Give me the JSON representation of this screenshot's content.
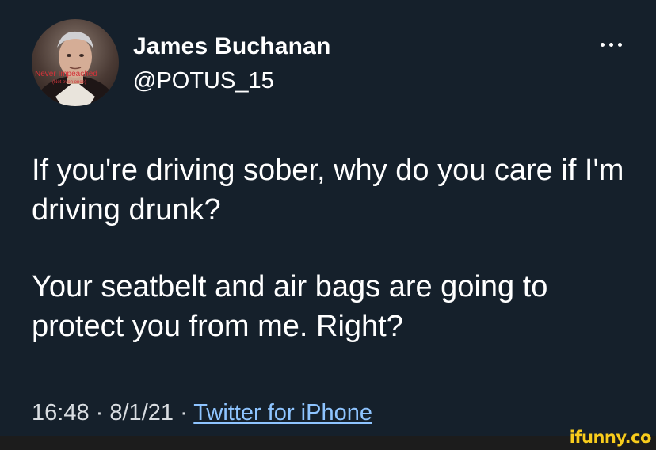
{
  "tweet": {
    "display_name": "James Buchanan",
    "handle": "@POTUS_15",
    "avatar_overlay_text": "Never Impeached",
    "avatar_overlay_subtext": "(Not even once)",
    "paragraphs": [
      "If you're driving sober, why do you care if I'm driving drunk?",
      "Your seatbelt and air bags are going to protect you from me. Right?"
    ],
    "time": "16:48",
    "date": "8/1/21",
    "separator": "·",
    "source": "Twitter for iPhone"
  },
  "watermark": "ifunny.co",
  "colors": {
    "background": "#15202b",
    "link": "#8ec4ff",
    "overlay_text": "#d4333a",
    "watermark": "#f8cc1c"
  },
  "icons": {
    "more": "more-horizontal-icon"
  }
}
